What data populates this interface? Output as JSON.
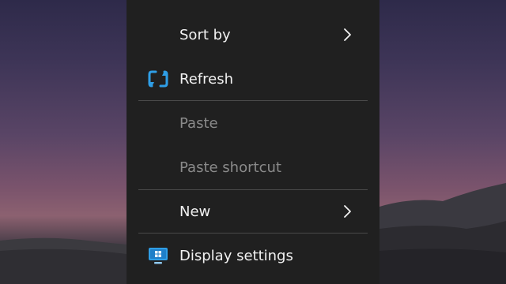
{
  "menu": {
    "items": [
      {
        "label": "Sort by",
        "icon": "",
        "submenu": true,
        "disabled": false
      },
      {
        "label": "Refresh",
        "icon": "refresh-icon",
        "submenu": false,
        "disabled": false
      },
      {
        "label": "Paste",
        "icon": "",
        "submenu": false,
        "disabled": true
      },
      {
        "label": "Paste shortcut",
        "icon": "",
        "submenu": false,
        "disabled": true
      },
      {
        "label": "New",
        "icon": "",
        "submenu": true,
        "disabled": false
      },
      {
        "label": "Display settings",
        "icon": "display-settings-icon",
        "submenu": false,
        "disabled": false
      }
    ]
  },
  "colors": {
    "menu_background": "#202020",
    "text": "#f2f2f2",
    "disabled_text": "#8a8a8a",
    "separator": "#4a4a4a",
    "accent": "#2f9ee6"
  }
}
